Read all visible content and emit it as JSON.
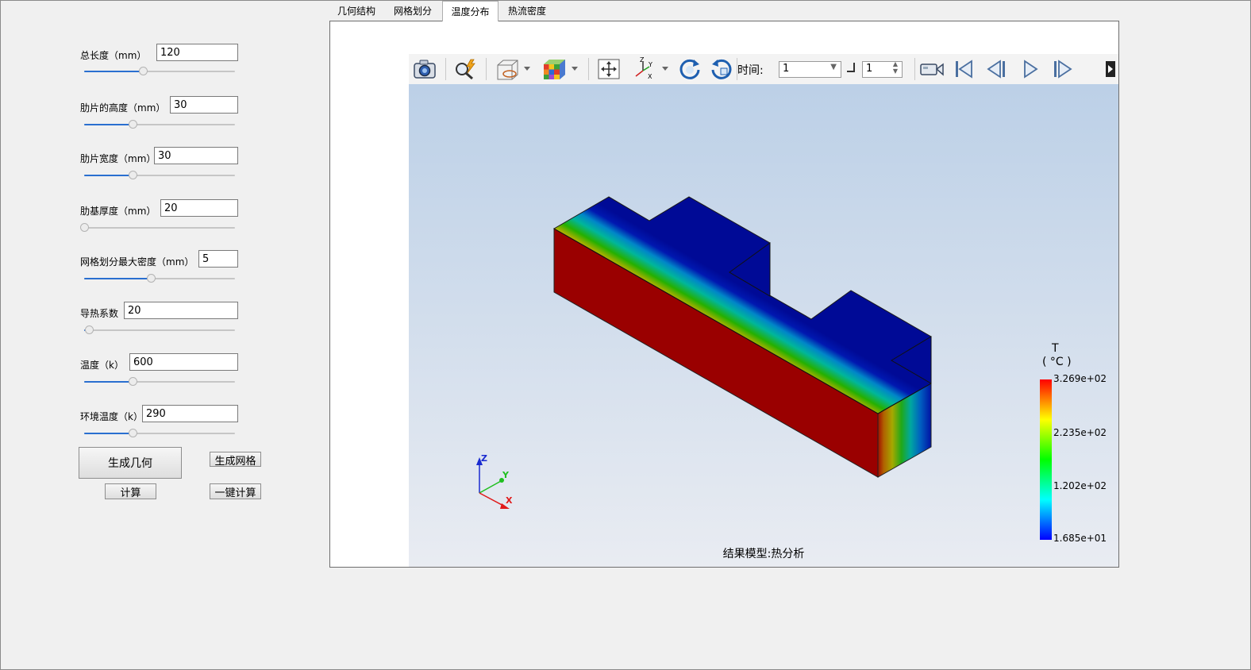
{
  "params": [
    {
      "label": "总长度（mm）",
      "value": "120",
      "slider": 0.39
    },
    {
      "label": "肋片的高度（mm）",
      "value": "30",
      "slider": 0.32
    },
    {
      "label": "肋片宽度（mm）",
      "value": "30",
      "slider": 0.32
    },
    {
      "label": "肋基厚度（mm）",
      "value": "20",
      "slider": 0.0
    },
    {
      "label": "网格划分最大密度（mm）",
      "value": "5",
      "slider": 0.44
    },
    {
      "label": "导热系数",
      "value": "20",
      "slider": 0.03
    },
    {
      "label": "温度（k）",
      "value": "600",
      "slider": 0.32
    },
    {
      "label": "环境温度（k）",
      "value": "290",
      "slider": 0.32
    }
  ],
  "buttons": {
    "generate_geometry": "生成几何",
    "generate_mesh": "生成网格",
    "compute": "计算",
    "one_click_compute": "一键计算"
  },
  "tabs": [
    {
      "label": "几何结构",
      "active": false
    },
    {
      "label": "网格划分",
      "active": false
    },
    {
      "label": "温度分布",
      "active": true
    },
    {
      "label": "热流密度",
      "active": false
    }
  ],
  "toolbar": {
    "time_label": "时间:",
    "time_value": "1",
    "step_value": "1",
    "icons": [
      "camera-icon",
      "probe-icon",
      "display-style-icon",
      "colormap-cube-icon",
      "fit-view-icon",
      "axis-view-icon",
      "rotate-cw-icon",
      "rotate-ccw-icon",
      "record-video-icon",
      "first-frame-icon",
      "prev-frame-icon",
      "play-icon",
      "next-frame-icon",
      "expand-icon"
    ]
  },
  "viewer": {
    "caption": "结果模型:热分析",
    "axes": {
      "x": "X",
      "y": "Y",
      "z": "Z"
    },
    "legend": {
      "title": "T",
      "unit": "( °C )",
      "ticks": [
        "3.269e+02",
        "2.235e+02",
        "1.202e+02",
        "1.685e+01"
      ],
      "colors": [
        "#ff0000",
        "#ffff00",
        "#00ff00",
        "#00ffff",
        "#0000ff"
      ]
    }
  }
}
